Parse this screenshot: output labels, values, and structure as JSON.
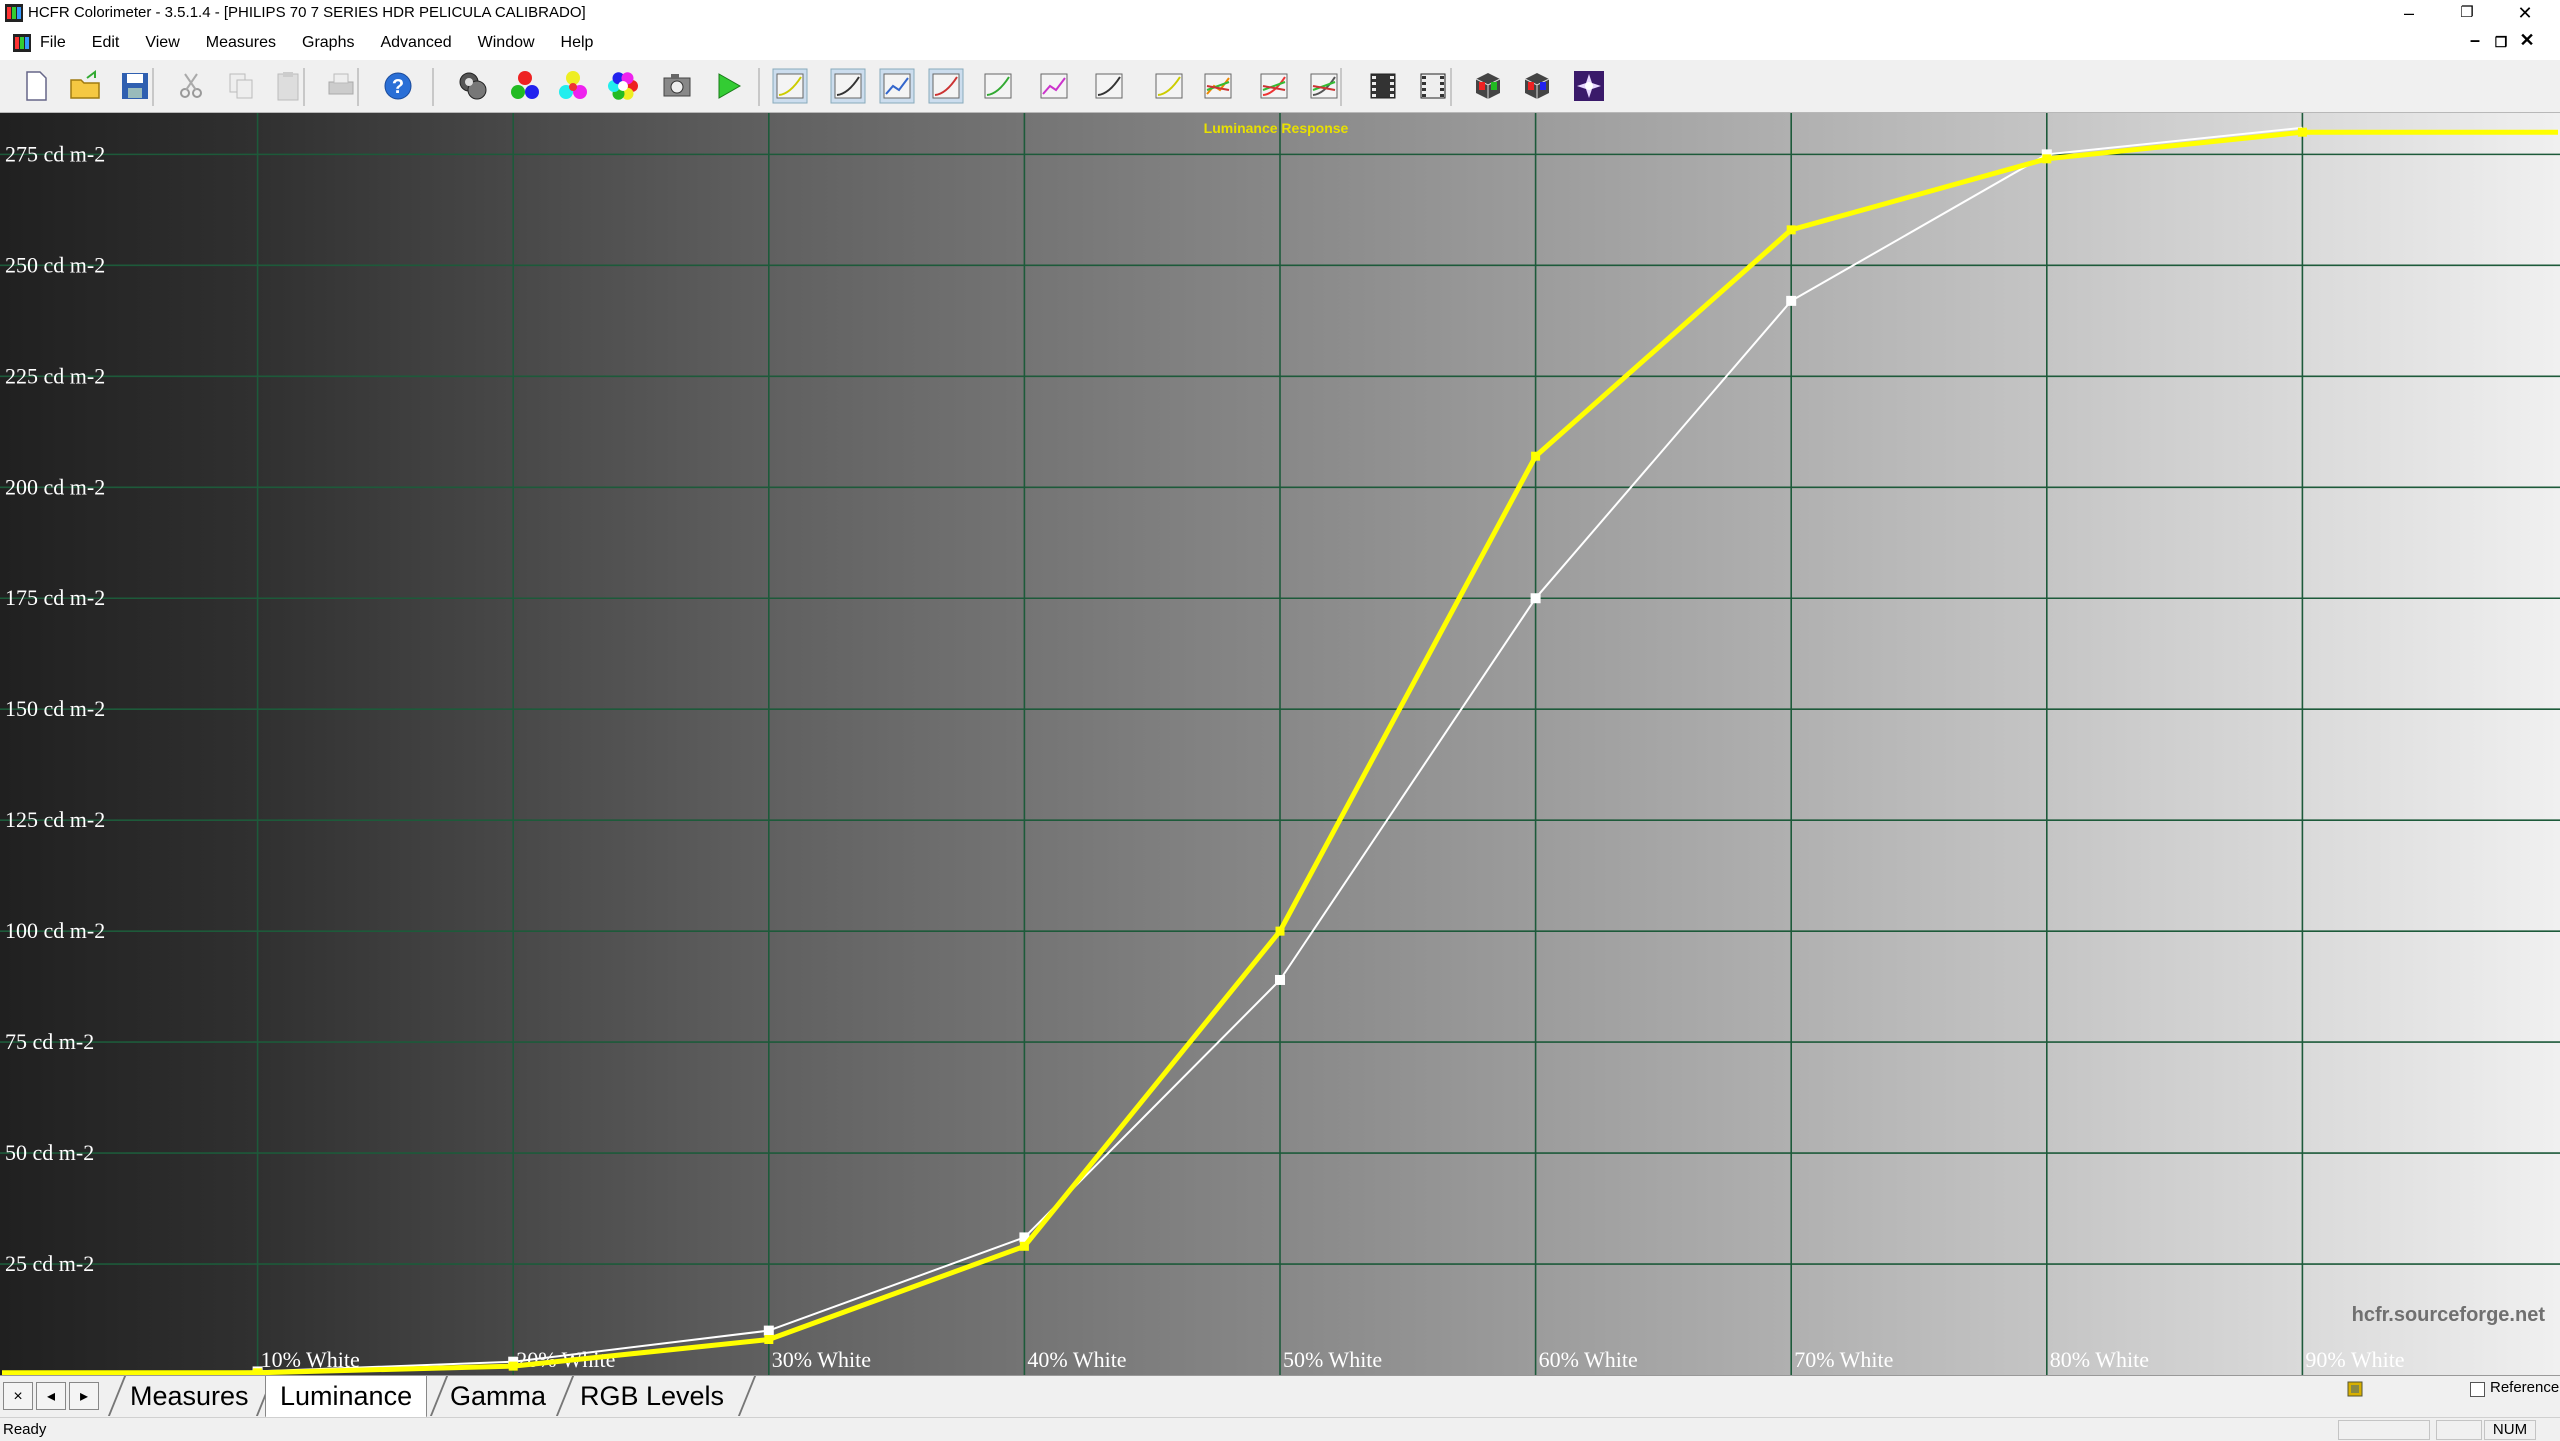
{
  "window": {
    "title": "HCFR Colorimeter - 3.5.1.4 - [PHILIPS 70 7 SERIES HDR PELICULA CALIBRADO]",
    "minimize_glyph": "–",
    "restore_glyph": "❐",
    "close_glyph": "✕"
  },
  "menu": {
    "items": [
      "File",
      "Edit",
      "View",
      "Measures",
      "Graphs",
      "Advanced",
      "Window",
      "Help"
    ],
    "mdi_minimize_glyph": "–",
    "mdi_restore_glyph": "❐",
    "mdi_close_glyph": "✕"
  },
  "toolbar": {
    "icons": [
      "new-icon",
      "open-icon",
      "save-icon",
      "cut-icon",
      "copy-icon",
      "paste-icon",
      "print-icon",
      "help-icon",
      "sensor-icon",
      "primaries-icon",
      "secondaries-icon",
      "colors-icon",
      "camera-icon",
      "play-icon",
      "graph-icon-1",
      "graph-icon-2",
      "graph-icon-3",
      "graph-icon-4",
      "graph-icon-5",
      "graph-icon-6",
      "graph-icon-7",
      "graph-icon-8",
      "graph-icon-9",
      "graph-icon-10",
      "graph-icon-11",
      "film-icon",
      "film-icon-2",
      "cube-icon-1",
      "cube-icon-2",
      "star-icon"
    ]
  },
  "chart_data": {
    "type": "line",
    "title": "Luminance Response",
    "watermark": "hcfr.sourceforge.net",
    "xlabel": "",
    "ylabel": "",
    "y_unit": "cd m-2",
    "ylim": [
      0,
      285
    ],
    "y_ticks": [
      25,
      50,
      75,
      100,
      125,
      150,
      175,
      200,
      225,
      250,
      275
    ],
    "x_tick_labels": [
      "10% White",
      "20% White",
      "30% White",
      "40% White",
      "50% White",
      "60% White",
      "70% White",
      "80% White",
      "90% White"
    ],
    "x": [
      0,
      10,
      20,
      30,
      40,
      50,
      60,
      70,
      80,
      90,
      100
    ],
    "series": [
      {
        "color": "#ffff00",
        "values": [
          0.5,
          0.5,
          2,
          8,
          29,
          100,
          207,
          258,
          274,
          280,
          280
        ]
      },
      {
        "color": "#ffffff",
        "values": [
          0.5,
          0.8,
          3,
          10,
          31,
          89,
          175,
          242,
          275,
          281,
          null
        ]
      }
    ],
    "grid": true,
    "background": "gradient black-to-white"
  },
  "tabs": {
    "items": [
      "Measures",
      "Luminance",
      "Gamma",
      "RGB Levels"
    ],
    "active": "Luminance",
    "nav": [
      "×",
      "◂",
      "▸"
    ],
    "reference_label": "Reference"
  },
  "status": {
    "ready": "Ready",
    "num": "NUM"
  }
}
